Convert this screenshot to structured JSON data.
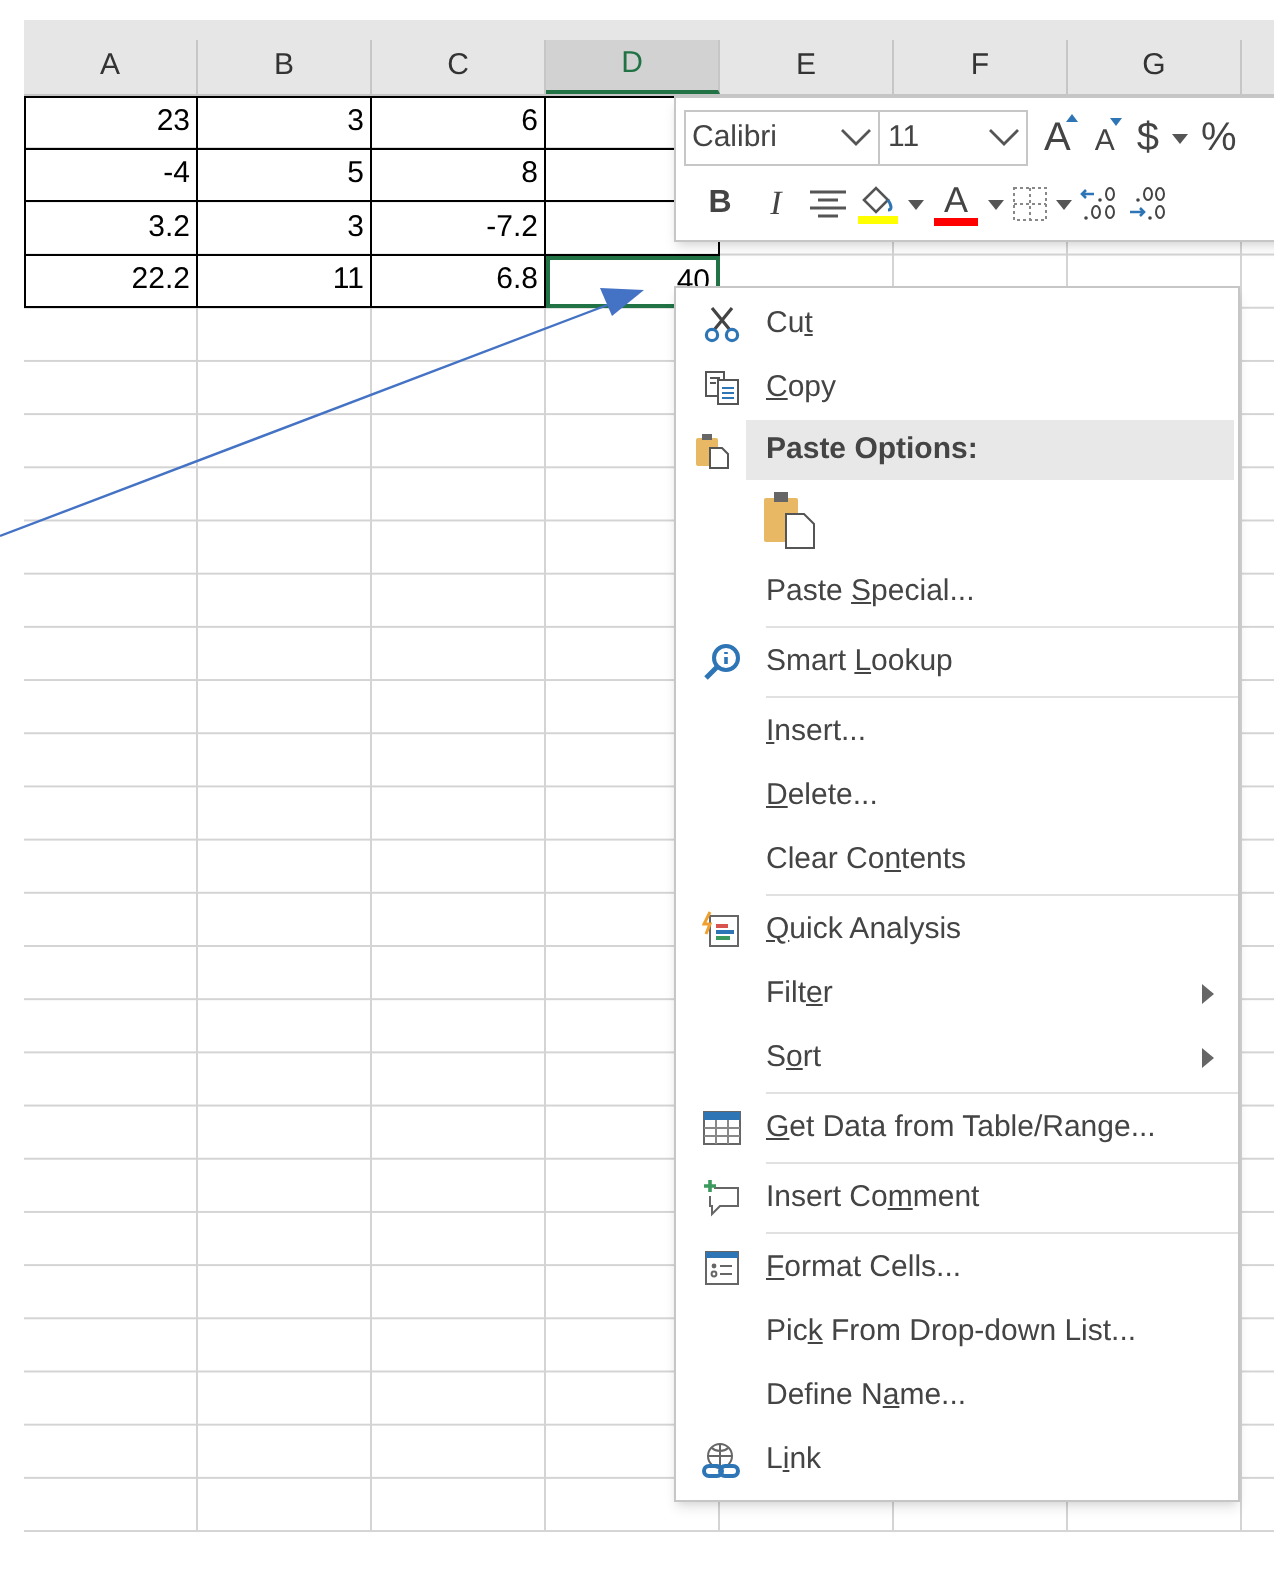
{
  "sheet": {
    "columns": [
      {
        "label": "A",
        "selected": false
      },
      {
        "label": "B",
        "selected": false
      },
      {
        "label": "C",
        "selected": false
      },
      {
        "label": "D",
        "selected": true
      },
      {
        "label": "E",
        "selected": false
      },
      {
        "label": "F",
        "selected": false
      },
      {
        "label": "G",
        "selected": false
      }
    ],
    "rows": [
      {
        "cells": [
          {
            "value": "23",
            "selected": false
          },
          {
            "value": "3",
            "selected": false
          },
          {
            "value": "6",
            "selected": false
          },
          {
            "selected": false
          }
        ]
      },
      {
        "cells": [
          {
            "value": "-4",
            "selected": false
          },
          {
            "value": "5",
            "selected": false
          },
          {
            "value": "8",
            "selected": false
          },
          {
            "selected": false
          }
        ]
      },
      {
        "cells": [
          {
            "value": "3.2",
            "selected": false
          },
          {
            "value": "3",
            "selected": false
          },
          {
            "value": "-7.2",
            "selected": false
          },
          {
            "selected": false
          }
        ]
      },
      {
        "cells": [
          {
            "value": "22.2",
            "selected": false
          },
          {
            "value": "11",
            "selected": false
          },
          {
            "value": "6.8",
            "selected": false
          },
          {
            "value": "40",
            "selected": true
          }
        ]
      }
    ]
  },
  "mini_toolbar": {
    "font": {
      "value": "Calibri"
    },
    "size": {
      "value": "11"
    },
    "row_1": [
      {
        "kind": "grow-font",
        "label": "A"
      },
      {
        "kind": "shrink-font",
        "label": "A"
      },
      {
        "kind": "currency",
        "label": "$"
      },
      {
        "kind": "dropdown"
      },
      {
        "kind": "percent",
        "label": "%"
      }
    ],
    "row_2": [
      {
        "kind": "bold",
        "label": "B"
      },
      {
        "kind": "italic",
        "label": "I"
      },
      {
        "kind": "center"
      },
      {
        "kind": "fill-color"
      },
      {
        "kind": "dropdown"
      },
      {
        "kind": "font-color",
        "label": "A"
      },
      {
        "kind": "dropdown"
      },
      {
        "kind": "borders"
      },
      {
        "kind": "dropdown"
      },
      {
        "kind": "increase-decimal"
      },
      {
        "kind": "decrease-decimal"
      }
    ]
  },
  "context_menu": [
    {
      "kind": "cut",
      "label_start": "Cu",
      "access_key": "t"
    },
    {
      "kind": "copy",
      "access_key": "C",
      "label_end": "opy"
    },
    {
      "kind": "paste-options",
      "label_start": "Paste Options:"
    },
    {
      "kind": "paste-icons"
    },
    {
      "kind": "paste-special",
      "label_start": "Paste ",
      "access_key": "S",
      "label_end": "pecial..."
    },
    {
      "kind": "separator"
    },
    {
      "kind": "smart-lookup",
      "label_start": "Smart ",
      "access_key": "L",
      "label_end": "ookup"
    },
    {
      "kind": "separator"
    },
    {
      "kind": "insert",
      "access_key": "I",
      "label_end": "nsert..."
    },
    {
      "kind": "delete",
      "access_key": "D",
      "label_end": "elete..."
    },
    {
      "kind": "clear-contents",
      "label_start": "Clear Co",
      "access_key": "n",
      "label_end": "tents"
    },
    {
      "kind": "separator"
    },
    {
      "kind": "quick-analysis",
      "access_key": "Q",
      "label_end": "uick Analysis"
    },
    {
      "kind": "filter",
      "label_start": "Filt",
      "access_key": "e",
      "label_end": "r"
    },
    {
      "kind": "sort",
      "label_start": "S",
      "access_key": "o",
      "label_end": "rt"
    },
    {
      "kind": "separator"
    },
    {
      "kind": "get-data",
      "access_key": "G",
      "label_end": "et Data from Table/Range..."
    },
    {
      "kind": "separator"
    },
    {
      "kind": "insert-comment",
      "label_start": "Insert Co",
      "access_key": "m",
      "label_end": "ment"
    },
    {
      "kind": "separator"
    },
    {
      "kind": "format-cells",
      "access_key": "F",
      "label_end": "ormat Cells..."
    },
    {
      "kind": "pick-from-list",
      "label_start": "Pic",
      "access_key": "k",
      "label_end": " From Drop-down List..."
    },
    {
      "kind": "define-name",
      "label_start": "Define N",
      "access_key": "a",
      "label_end": "me..."
    },
    {
      "kind": "link",
      "label_start": "L",
      "access_key": "i",
      "label_end": "nk"
    }
  ]
}
